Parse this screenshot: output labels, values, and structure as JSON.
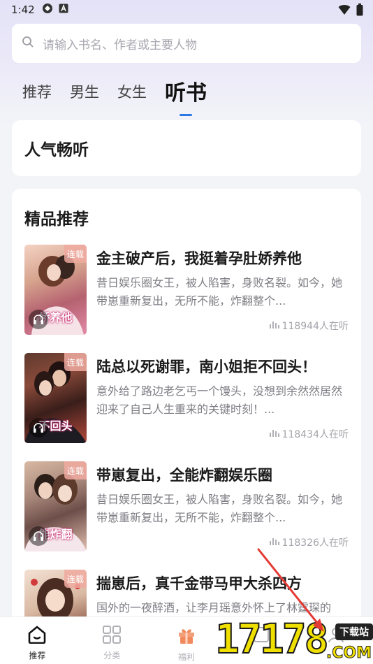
{
  "status_bar": {
    "time": "1:42"
  },
  "search": {
    "placeholder": "请输入书名、作者或主要人物"
  },
  "tabs": [
    {
      "label": "推荐"
    },
    {
      "label": "男生"
    },
    {
      "label": "女生"
    },
    {
      "label": "听书"
    }
  ],
  "hot_section": {
    "title": "人气畅听"
  },
  "featured": {
    "title": "精品推荐",
    "books": [
      {
        "title": "金主破产后，我挺着孕肚娇养他",
        "desc": "昔日娱乐圈女王，被人陷害，身败名裂。如今，她带崽重新复出，无所不能，炸翻整个...",
        "listeners": "118944人在听",
        "badge": "连载",
        "cover_text": "娇养他"
      },
      {
        "title": "陆总以死谢罪，南小姐拒不回头！",
        "desc": "意外给了路边老乞丐一个馒头，没想到余然然居然迎来了自己人生重来的关键时刻！...",
        "listeners": "118434人在听",
        "badge": "连载",
        "cover_text": "不回头"
      },
      {
        "title": "带崽复出，全能炸翻娱乐圈",
        "desc": "昔日娱乐圈女王，被人陷害，身败名裂。如今，她带崽重新复出，无所不能，炸翻整个...",
        "listeners": "118326人在听",
        "badge": "连载",
        "cover_text": "能炸翻"
      },
      {
        "title": "揣崽后，真千金带马甲大杀四方",
        "desc": "国外的一夜醉酒，让李月瑶意外怀上了林霆琛的",
        "listeners": "",
        "badge": "连载",
        "cover_text": ""
      }
    ]
  },
  "bottom_nav": [
    {
      "label": "推荐",
      "icon": "home-icon"
    },
    {
      "label": "分类",
      "icon": "grid-icon"
    },
    {
      "label": "福利",
      "icon": "gift-icon"
    },
    {
      "label": "",
      "icon": "bookshelf-icon"
    },
    {
      "label": "",
      "icon": "profile-icon"
    }
  ],
  "watermark": {
    "number": "17178",
    "badge": "下载站",
    "suffix": ".COM"
  },
  "colors": {
    "accent": "#2a78e4",
    "gift": "#f08a5d"
  }
}
